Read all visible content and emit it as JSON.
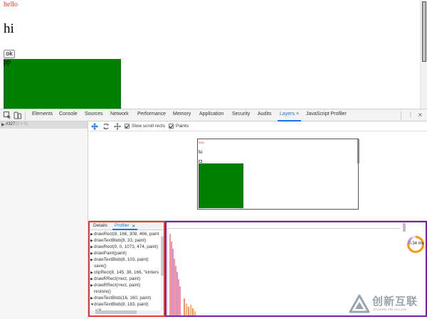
{
  "page": {
    "hello": "hello",
    "hi": "hi",
    "ok_button": "ok",
    "pp": "pp"
  },
  "devtools": {
    "tabs": [
      "Elements",
      "Console",
      "Sources",
      "Network",
      "Performance",
      "Memory",
      "Application",
      "Security",
      "Audits",
      "Layers",
      "JavaScript Profiler"
    ],
    "active_tab": "Layers",
    "close_glyph": "×",
    "more_glyph": "⋮",
    "close_devtools": "×"
  },
  "layers_tree": {
    "node_id": "#327",
    "node_size": "(0 × 0)"
  },
  "layers_toolbar": {
    "slow_scroll_rects": "Slow scroll rects",
    "paints": "Paints"
  },
  "thumbnail": {
    "hello": "hello",
    "hi": "hi"
  },
  "details": {
    "tabs": [
      "Details",
      "Profiler"
    ],
    "active_tab": "Profiler",
    "close_glyph": "×",
    "commands": [
      {
        "arrow": "▶",
        "text": "drawRect(8, 166, 308, 466, paint"
      },
      {
        "arrow": "▶",
        "text": "drawTextBlob(8, 33, paint)"
      },
      {
        "arrow": "▶",
        "text": "drawRect(0, 0, 1073, 474, paint)"
      },
      {
        "arrow": "▶",
        "text": "drawPaint(paint)"
      },
      {
        "arrow": "▶",
        "text": "drawTextBlob(8, 103, paint)"
      },
      {
        "arrow": "",
        "text": "save()"
      },
      {
        "arrow": "▶",
        "text": "clipRect(8, 145, 38, 166, \"kInters"
      },
      {
        "arrow": "▶",
        "text": "drawRRect(rrect, paint)"
      },
      {
        "arrow": "▶",
        "text": "drawRRect(rrect, paint)"
      },
      {
        "arrow": "",
        "text": "restore()"
      },
      {
        "arrow": "▶",
        "text": "drawTextBlob(16, 160, paint)"
      },
      {
        "arrow": "▼",
        "text": "drawTextBlob(8, 183, paint)"
      },
      {
        "arrow": "",
        "text": "  x:8"
      }
    ]
  },
  "profiler": {
    "time_label": "0.34 ms",
    "bars_fraction": [
      0.95,
      0.86,
      0.78,
      0.66,
      0.58,
      0.5,
      0.42,
      0.34,
      0.2,
      0.14,
      0.1,
      0.12,
      0.08,
      0.05
    ],
    "bar_colors": [
      "#ef9a9a",
      "#f48fb1",
      "#ce93d8",
      "#ef9a9a",
      "#f48fb1",
      "#ce93d8",
      "#ef9a9a",
      "#f48fb1",
      "#ff8a65",
      "#ffb74d",
      "#ff8a65",
      "#ffb74d",
      "#ff8a65",
      "#ffb74d"
    ]
  },
  "watermark": {
    "title": "创新互联",
    "subtitle": "CHUANG XIN HU LIAN"
  },
  "colors": {
    "accent": "#1a73e8",
    "red_frame": "#e53935",
    "purple_frame": "#7b1fa2",
    "green": "#008000"
  }
}
